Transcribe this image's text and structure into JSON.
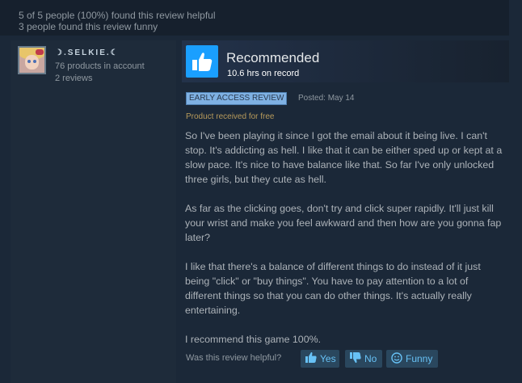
{
  "helpful": {
    "line1": "5 of 5 people (100%) found this review helpful",
    "line2": "3 people found this review funny"
  },
  "author": {
    "name": "☽.SELKIE.☾",
    "products": "76 products in account",
    "reviews": "2 reviews"
  },
  "review": {
    "verdict": "Recommended",
    "hours": "10.6 hrs on record",
    "badge": "EARLY ACCESS REVIEW",
    "posted": "Posted: May 14",
    "received": "Product received for free",
    "paragraphs": [
      "So I've been playing it since I got the email about it being live. I can't stop. It's addicting as hell. I like that it can be either sped up or kept at a slow pace. It's nice to have balance like that. So far I've only unlocked three girls, but they cute as hell.",
      "As far as the clicking goes, don't try and click super rapidly. It'll just kill your wrist and make you feel awkward and then how are you gonna fap later?",
      "I like that there's a balance of different things to do instead of it just being \"click\" or \"buy things\". You have to pay attention to a lot of different things so that you can do other things. It's actually really entertaining.",
      "I recommend this game 100%."
    ]
  },
  "footer": {
    "question": "Was this review helpful?",
    "yes": "Yes",
    "no": "No",
    "funny": "Funny"
  },
  "icons": {
    "thumb": "thumbs-up-icon",
    "yes": "thumbs-up-icon",
    "no": "thumbs-down-icon",
    "funny": "smiley-icon"
  },
  "colors": {
    "accent": "#1a9fff",
    "link": "#67c1f5",
    "badge_bg": "#7fb1e3"
  }
}
